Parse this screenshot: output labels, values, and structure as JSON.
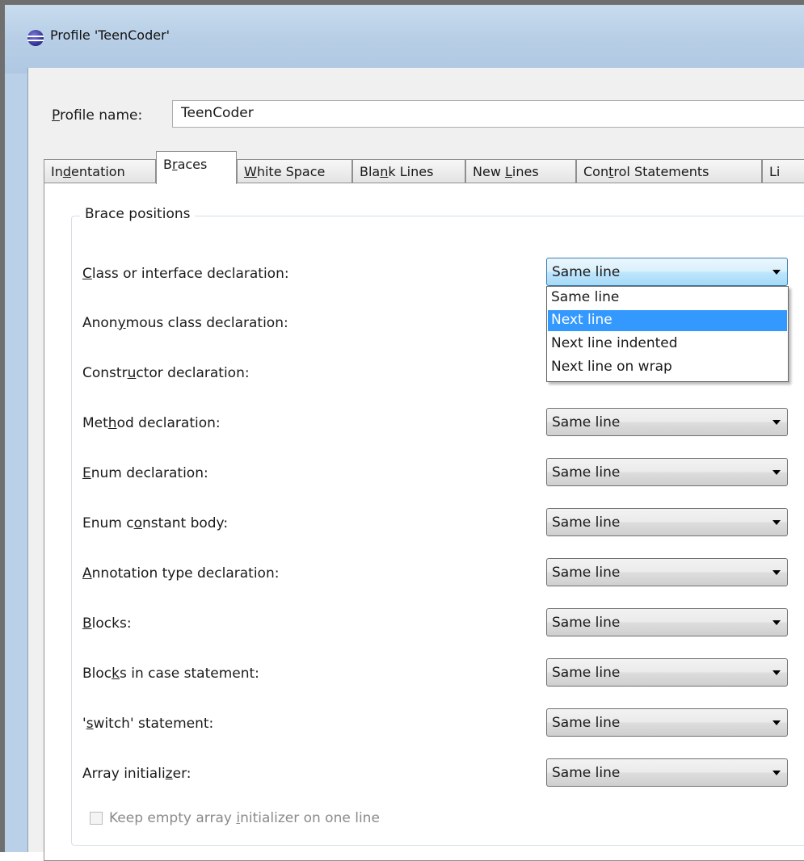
{
  "window": {
    "title": "Profile 'TeenCoder'",
    "icon": "eclipse-icon"
  },
  "profile": {
    "label_accesskey": "P",
    "label_rest": "rofile name:",
    "value": "TeenCoder"
  },
  "tabs": {
    "indentation": {
      "pre": "In",
      "key": "d",
      "post": "entation"
    },
    "braces": {
      "pre": "B",
      "key": "r",
      "post": "aces"
    },
    "white_space": {
      "pre": "",
      "key": "W",
      "post": "hite Space"
    },
    "blank_lines": {
      "pre": "Bla",
      "key": "n",
      "post": "k Lines"
    },
    "new_lines": {
      "pre": "New ",
      "key": "L",
      "post": "ines"
    },
    "control_statements": {
      "pre": "Con",
      "key": "t",
      "post": "rol Statements"
    },
    "line_wrapping": {
      "pre": "Li",
      "key": "",
      "post": ""
    },
    "active": "Braces"
  },
  "group": {
    "legend": "Brace positions"
  },
  "rows": {
    "class_decl": {
      "pre": "",
      "key": "C",
      "post": "lass or interface declaration:",
      "value": "Same line"
    },
    "anon_class": {
      "pre": "Anon",
      "key": "y",
      "post": "mous class declaration:"
    },
    "constructor": {
      "pre": "Constr",
      "key": "u",
      "post": "ctor declaration:"
    },
    "method": {
      "pre": "Met",
      "key": "h",
      "post": "od declaration:",
      "value": "Same line"
    },
    "enum_decl": {
      "pre": "",
      "key": "E",
      "post": "num declaration:",
      "value": "Same line"
    },
    "enum_const": {
      "pre": "Enum c",
      "key": "o",
      "post": "nstant body:",
      "value": "Same line"
    },
    "annotation": {
      "pre": "",
      "key": "A",
      "post": "nnotation type declaration:",
      "value": "Same line"
    },
    "blocks": {
      "pre": "",
      "key": "B",
      "post": "locks:",
      "value": "Same line"
    },
    "blocks_case": {
      "pre": "Bloc",
      "key": "k",
      "post": "s in case statement:",
      "value": "Same line"
    },
    "switch": {
      "pre": "'",
      "key": "s",
      "post": "witch' statement:",
      "value": "Same line"
    },
    "array_init": {
      "pre": "Array initiali",
      "key": "z",
      "post": "er:",
      "value": "Same line"
    }
  },
  "dropdown": {
    "options": [
      "Same line",
      "Next line",
      "Next line indented",
      "Next line on wrap"
    ],
    "highlighted": "Next line"
  },
  "keep_empty": {
    "pre": "Keep empty array ",
    "key": "i",
    "post": "nitializer on one line",
    "checked": false,
    "enabled": false
  },
  "colors": {
    "selection": "#3399ff",
    "titlebar": "#b9d0e8",
    "dialog_bg": "#f0f0f0"
  }
}
